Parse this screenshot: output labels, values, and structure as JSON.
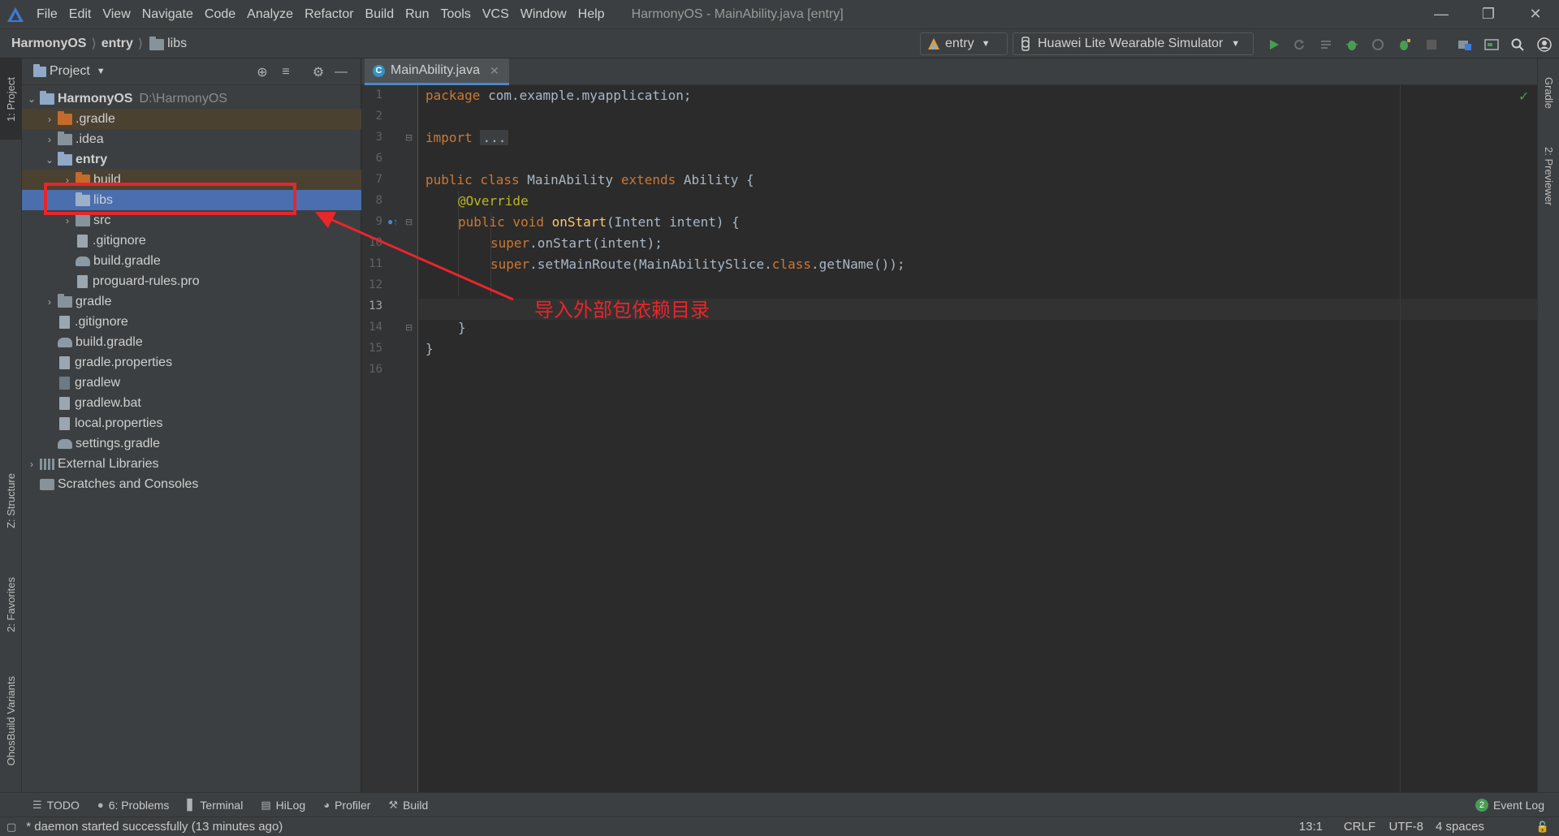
{
  "menubar": {
    "items": [
      "File",
      "Edit",
      "View",
      "Navigate",
      "Code",
      "Analyze",
      "Refactor",
      "Build",
      "Run",
      "Tools",
      "VCS",
      "Window",
      "Help"
    ],
    "window_title": "HarmonyOS - MainAbility.java [entry]"
  },
  "navbar": {
    "crumbs": [
      "HarmonyOS",
      "entry",
      "libs"
    ],
    "module_config": "entry",
    "device_config": "Huawei Lite Wearable Simulator"
  },
  "project_panel": {
    "title": "Project",
    "tree": [
      {
        "label": "HarmonyOS",
        "extra": "D:\\HarmonyOS"
      },
      {
        "label": ".gradle"
      },
      {
        "label": ".idea"
      },
      {
        "label": "entry"
      },
      {
        "label": "build"
      },
      {
        "label": "libs"
      },
      {
        "label": "src"
      },
      {
        "label": ".gitignore"
      },
      {
        "label": "build.gradle"
      },
      {
        "label": "proguard-rules.pro"
      },
      {
        "label": "gradle"
      },
      {
        "label": ".gitignore"
      },
      {
        "label": "build.gradle"
      },
      {
        "label": "gradle.properties"
      },
      {
        "label": "gradlew"
      },
      {
        "label": "gradlew.bat"
      },
      {
        "label": "local.properties"
      },
      {
        "label": "settings.gradle"
      },
      {
        "label": "External Libraries"
      },
      {
        "label": "Scratches and Consoles"
      }
    ]
  },
  "left_strip": {
    "project": "1: Project",
    "structure": "Z: Structure",
    "favorites": "2: Favorites",
    "variants": "OhosBuild Variants"
  },
  "right_strip": {
    "gradle": "Gradle",
    "previewer": "2: Previewer"
  },
  "editor": {
    "tab": "MainAbility.java",
    "line_numbers": [
      "1",
      "2",
      "3",
      "6",
      "7",
      "8",
      "9",
      "10",
      "11",
      "12",
      "13",
      "14",
      "15",
      "16"
    ],
    "code": {
      "l1_kw": "package",
      "l1_rest": " com.example.myapplication;",
      "l3_kw": "import",
      "l3_fold": "...",
      "l7_kw1": "public class",
      "l7_name": " MainAbility ",
      "l7_kw2": "extends",
      "l7_rest": " Ability {",
      "l8_ann": "@Override",
      "l9_kw": "public void",
      "l9_fn": "onStart",
      "l9_rest": "(Intent intent) {",
      "l10_kw": "super",
      "l10_rest": ".onStart(intent);",
      "l11_kw": "super",
      "l11_mid": ".setMainRoute(MainAbilitySlice.",
      "l11_kw2": "class",
      "l11_rest": ".getName());",
      "l14": "}",
      "l15": "}"
    }
  },
  "annotation": {
    "text": "导入外部包依赖目录"
  },
  "bottom_tools": {
    "todo": "TODO",
    "problems": "6: Problems",
    "terminal": "Terminal",
    "hilog": "HiLog",
    "profiler": "Profiler",
    "build": "Build",
    "event_log": "Event Log",
    "event_count": "2"
  },
  "status": {
    "message": "* daemon started successfully (13 minutes ago)",
    "position": "13:1",
    "line_sep": "CRLF",
    "encoding": "UTF-8",
    "indent": "4 spaces"
  },
  "colors": {
    "accent": "#4b6eaf",
    "annotation": "#e8262b",
    "run_green": "#499c54"
  }
}
